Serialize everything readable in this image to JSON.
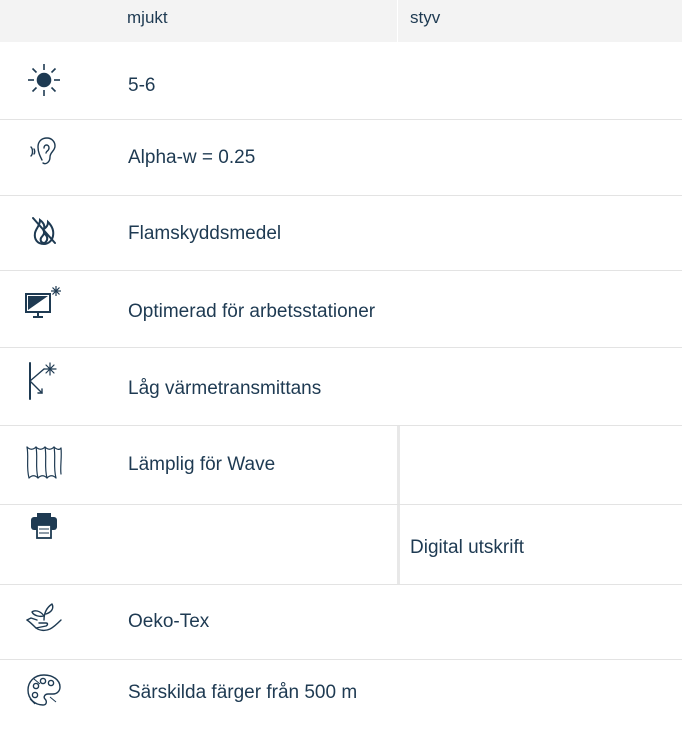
{
  "header": {
    "col1": "mjukt",
    "col2": "styv"
  },
  "rows": [
    {
      "icon": "sun-icon",
      "text": "5-6"
    },
    {
      "icon": "ear-sound-icon",
      "text": "Alpha-w = 0.25"
    },
    {
      "icon": "flame-retardant-icon",
      "text": "Flamskyddsmedel"
    },
    {
      "icon": "workstation-monitor-icon",
      "text": "Optimerad för arbetsstationer"
    },
    {
      "icon": "heat-transmittance-icon",
      "text": "Låg värmetransmittans"
    },
    {
      "icon": "wave-curtain-icon",
      "text": "Lämplig för Wave"
    },
    {
      "icon": "printer-icon",
      "text": "Digital utskrift"
    },
    {
      "icon": "plant-hand-icon",
      "text": "Oeko-Tex"
    },
    {
      "icon": "palette-icon",
      "text": "Särskilda färger från 500 m"
    }
  ],
  "colors": {
    "text": "#1e3a52",
    "header_bg": "#f3f3f3",
    "divider": "#e3e3e3"
  }
}
